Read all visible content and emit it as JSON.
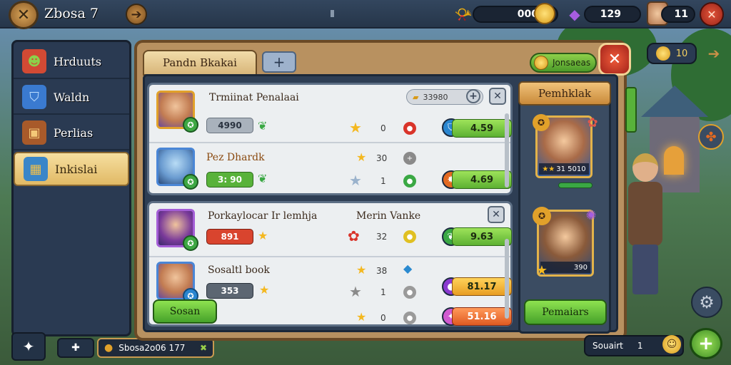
{
  "topbar": {
    "title": "Zbosa 7",
    "gold_value": "000",
    "gem_value": "129",
    "profile_value": "11"
  },
  "sidebar": {
    "items": [
      {
        "label": "Hrduuts",
        "icon": "goblin-icon"
      },
      {
        "label": "Waldn",
        "icon": "shield-icon"
      },
      {
        "label": "Perlias",
        "icon": "chest-icon"
      },
      {
        "label": "Inkislai",
        "icon": "cube-icon",
        "active": true
      }
    ]
  },
  "bottom_left": {
    "info_text": "Sbosa2o06 177"
  },
  "panel": {
    "tab_label": "Pandn Bkakai",
    "tab_add_label": "+",
    "gold_label": "Jonsaeas",
    "close_label": "✕"
  },
  "cards": {
    "card1": {
      "title": "Trmiinat Penalaai",
      "price": "33980",
      "row1": {
        "chip": "4990",
        "num": "0",
        "value": "4.59"
      },
      "row2": {
        "name": "Pez Dhardk",
        "chip": "3: 90",
        "num_a": "30",
        "num_b": "1",
        "value": "4.69"
      }
    },
    "card2": {
      "title": "Porkaylocar Ir lemhja",
      "subtitle": "Merin Vanke",
      "row1": {
        "chip": "891",
        "num": "32",
        "value": "9.63"
      },
      "row2": {
        "name": "Sosaltl book",
        "chip": "353",
        "num_a": "38",
        "num_b": "1",
        "num_c": "0",
        "value_a": "81.17",
        "value_b": "51.16"
      },
      "button_label": "Sosan"
    }
  },
  "right_col": {
    "title": "Pemhklak",
    "hero1_level": "31 5010",
    "hero2_level": "390",
    "button_label": "Pemaiars"
  },
  "right_side": {
    "gold_value": "10"
  },
  "bottom_right": {
    "label": "Souairt",
    "value": "1"
  },
  "colors": {
    "accent_green": "#58b23a",
    "accent_red": "#d9442e",
    "accent_gold": "#e1b965"
  }
}
